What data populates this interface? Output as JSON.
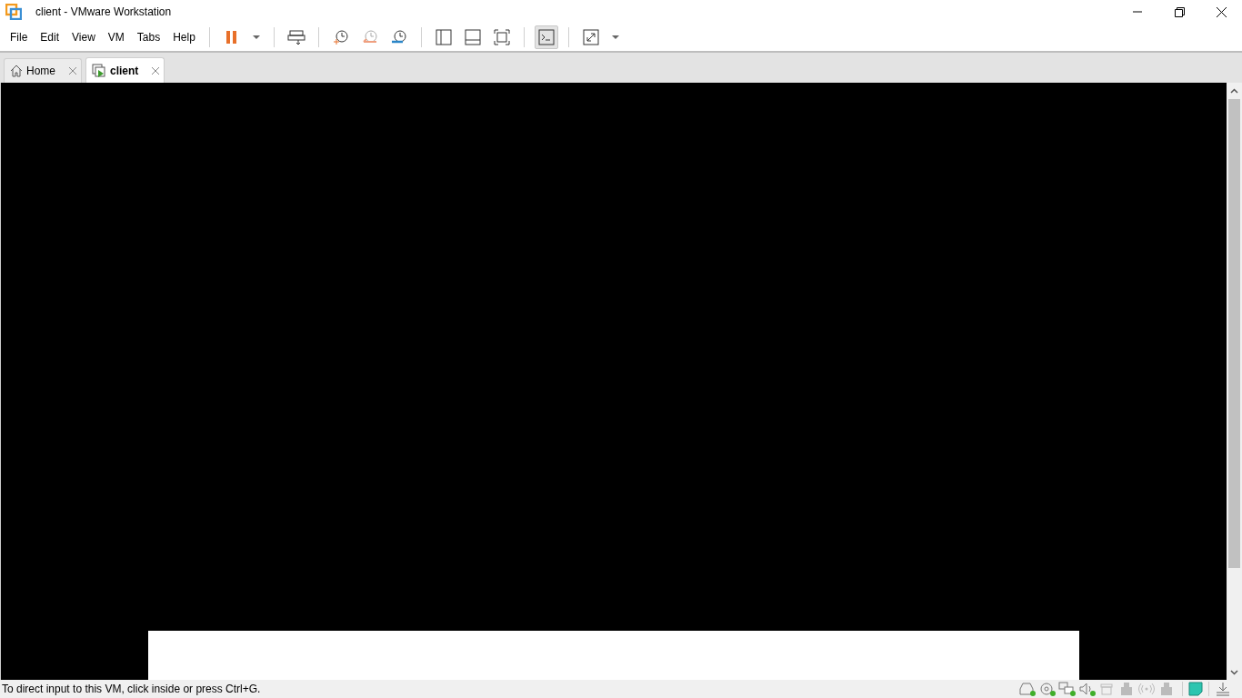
{
  "window": {
    "title": "client - VMware Workstation"
  },
  "menu": [
    "File",
    "Edit",
    "View",
    "VM",
    "Tabs",
    "Help"
  ],
  "toolbar": [
    [
      {
        "kind": "pause",
        "selected": false
      },
      {
        "kind": "dropdown",
        "selected": false
      }
    ],
    [
      {
        "kind": "send-keys",
        "selected": false
      }
    ],
    [
      {
        "kind": "snapshot",
        "selected": false
      },
      {
        "kind": "revert",
        "selected": false
      },
      {
        "kind": "manager",
        "selected": false
      }
    ],
    [
      {
        "kind": "library",
        "selected": false
      },
      {
        "kind": "thumbnail",
        "selected": false
      },
      {
        "kind": "fullscreen",
        "selected": false
      }
    ],
    [
      {
        "kind": "console",
        "selected": true
      }
    ],
    [
      {
        "kind": "stretch",
        "selected": false
      },
      {
        "kind": "dropdown",
        "selected": false
      }
    ]
  ],
  "tabs": [
    {
      "label": "Home",
      "kind": "home",
      "selected": false
    },
    {
      "label": "client",
      "kind": "vm",
      "selected": true
    }
  ],
  "status_bar": {
    "message": "To direct input to this VM, click inside or press Ctrl+G.",
    "devices": [
      {
        "kind": "disk",
        "connected": true
      },
      {
        "kind": "cd",
        "connected": true
      },
      {
        "kind": "network",
        "connected": true
      },
      {
        "kind": "sound",
        "connected": true
      },
      {
        "kind": "printer",
        "connected": false
      },
      {
        "kind": "usb",
        "connected": false
      },
      {
        "kind": "wireless",
        "connected": false
      },
      {
        "kind": "usb",
        "connected": false
      }
    ]
  }
}
